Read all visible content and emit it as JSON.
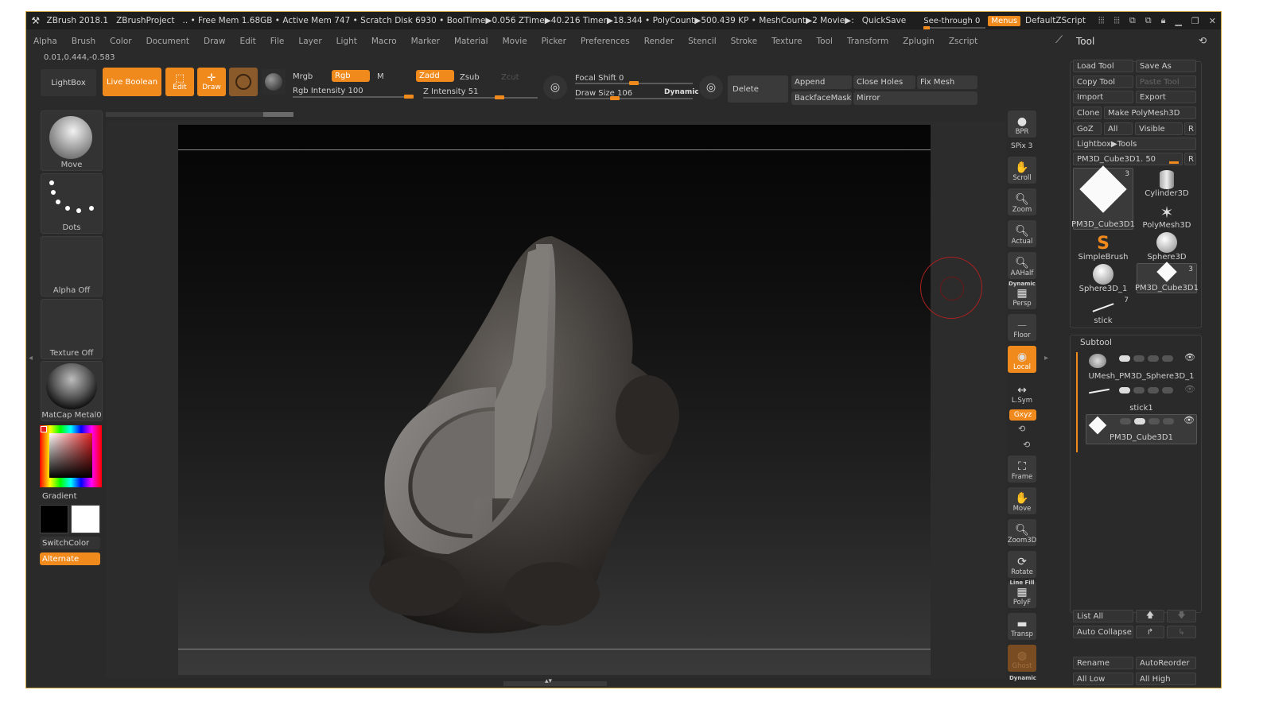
{
  "titlebar": {
    "app": "ZBrush 2018.1",
    "project": "ZBrushProject",
    "stats": ".. • Free Mem 1.68GB • Active Mem 747 • Scratch Disk 6930 •  BoolTime▶0.056 ZTime▶40.216 Timer▶18.344 • PolyCount▶500.439 KP  • MeshCount▶2  Movie▶:",
    "quicksave": "QuickSave",
    "see_through": "See-through  0",
    "menus": "Menus",
    "zscript": "DefaultZScript"
  },
  "menubar": [
    "Alpha",
    "Brush",
    "Color",
    "Document",
    "Draw",
    "Edit",
    "File",
    "Layer",
    "Light",
    "Macro",
    "Marker",
    "Material",
    "Movie",
    "Picker",
    "Preferences",
    "Render",
    "Stencil",
    "Stroke",
    "Texture",
    "Tool",
    "Transform",
    "Zplugin",
    "Zscript"
  ],
  "coords": "0.01,0.444,-0.583",
  "shelf": {
    "lightbox": "LightBox",
    "live_boolean": "Live Boolean",
    "edit": "Edit",
    "draw": "Draw",
    "mrgb": "Mrgb",
    "rgb": "Rgb",
    "m": "M",
    "rgb_intensity": "Rgb Intensity 100",
    "rgb_intensity_value": 100,
    "zadd": "Zadd",
    "zsub": "Zsub",
    "zcut": "Zcut",
    "z_intensity": "Z Intensity 51",
    "z_intensity_value": 51,
    "focal_shift": "Focal Shift 0",
    "draw_size": "Draw Size 106",
    "dynamic": "Dynamic",
    "delete": "Delete",
    "append": "Append",
    "close_holes": "Close Holes",
    "fix_mesh": "Fix Mesh",
    "backface_mask": "BackfaceMask",
    "mirror": "Mirror"
  },
  "left_palette": {
    "brush": "Move",
    "stroke": "Dots",
    "alpha": "Alpha Off",
    "texture": "Texture Off",
    "material": "MatCap Metal0",
    "gradient": "Gradient",
    "switch_color": "SwitchColor",
    "alternate": "Alternate"
  },
  "nav": {
    "bpr": "BPR",
    "spix": "SPix 3",
    "scroll": "Scroll",
    "zoom": "Zoom",
    "actual": "Actual",
    "aahalf": "AAHalf",
    "dynamic": "Dynamic",
    "persp": "Persp",
    "floor": "Floor",
    "local": "Local",
    "lsym": "L.Sym",
    "xyz": "Gxyz",
    "frame": "Frame",
    "move": "Move",
    "zoom3d": "Zoom3D",
    "rotate": "Rotate",
    "linefill": "Line Fill",
    "polyf": "PolyF",
    "transp": "Transp",
    "ghost": "Ghost",
    "dynamic2": "Dynamic"
  },
  "tool": {
    "title": "Tool",
    "load_tool": "Load Tool",
    "save_as": "Save As",
    "copy_tool": "Copy Tool",
    "paste_tool": "Paste Tool",
    "import": "Import",
    "export": "Export",
    "clone": "Clone",
    "make_polymesh": "Make PolyMesh3D",
    "goz": "GoZ",
    "all": "All",
    "visible": "Visible",
    "r": "R",
    "lightbox_tools": "Lightbox▶Tools",
    "current": "PM3D_Cube3D1. 50",
    "items": [
      {
        "label": "PM3D_Cube3D1",
        "badge": "3"
      },
      {
        "label": "Cylinder3D",
        "badge": ""
      },
      {
        "label": "PolyMesh3D",
        "badge": ""
      },
      {
        "label": "SimpleBrush",
        "badge": ""
      },
      {
        "label": "Sphere3D",
        "badge": ""
      },
      {
        "label": "Sphere3D_1",
        "badge": ""
      },
      {
        "label": "PM3D_Cube3D1",
        "badge": "3"
      },
      {
        "label": "stick",
        "badge": "7"
      }
    ]
  },
  "subtool": {
    "title": "Subtool",
    "items": [
      "UMesh_PM3D_Sphere3D_1",
      "stick1",
      "PM3D_Cube3D1"
    ],
    "list_all": "List All",
    "auto_collapse": "Auto Collapse",
    "rename": "Rename",
    "auto_reorder": "AutoReorder",
    "all_low": "All Low",
    "all_high": "All High"
  },
  "colors": {
    "accent": "#f08a1c",
    "panel": "#2a2a2a",
    "border": "#c9a640"
  }
}
